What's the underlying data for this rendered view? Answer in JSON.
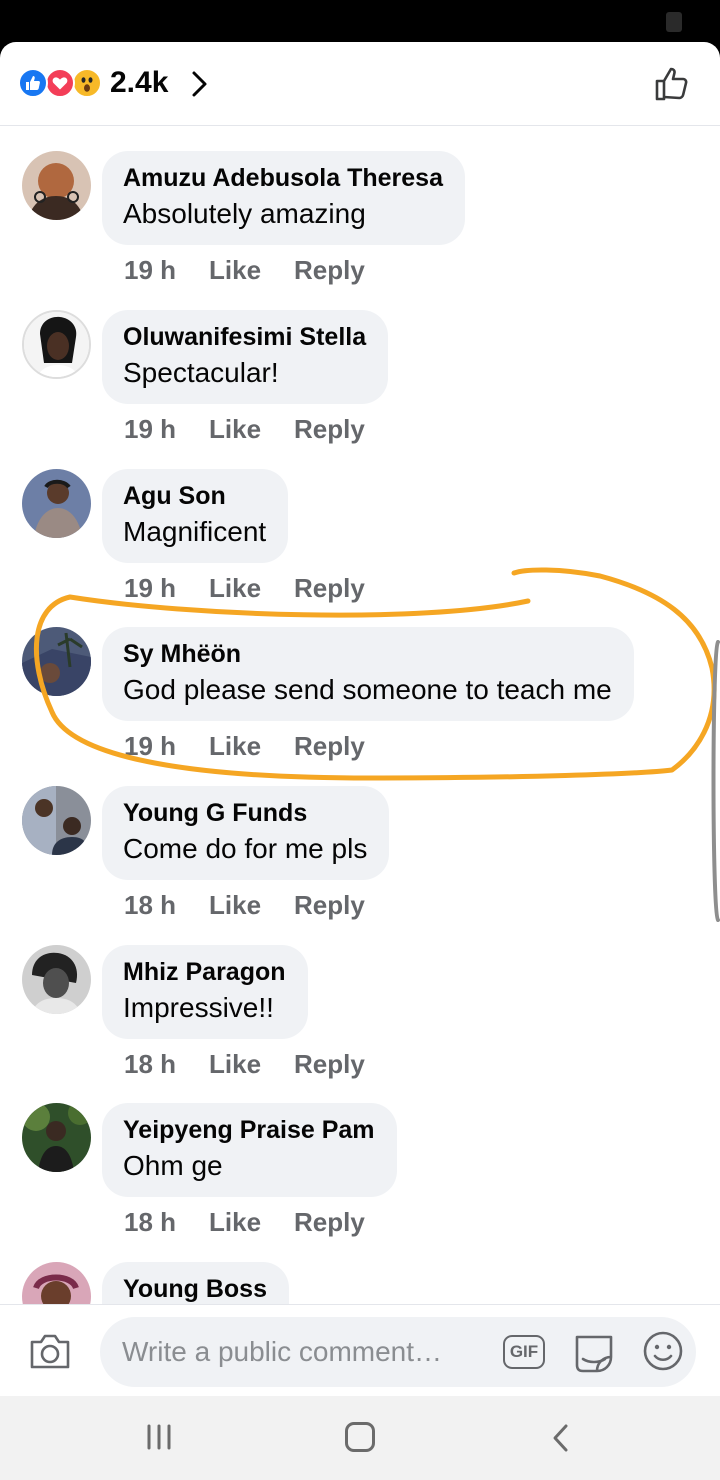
{
  "header": {
    "reaction_count": "2.4k",
    "reactions": [
      "like-icon",
      "love-icon",
      "wow-icon"
    ],
    "colors": {
      "like": "#1877f2",
      "love": "#f33e58",
      "wow": "#f7b928"
    }
  },
  "comments": [
    {
      "author": "Amuzu Adebusola Theresa",
      "text": "Absolutely amazing",
      "time": "19 h",
      "like": "Like",
      "reply": "Reply"
    },
    {
      "author": "Oluwanifesimi Stella",
      "text": "Spectacular!",
      "time": "19 h",
      "like": "Like",
      "reply": "Reply"
    },
    {
      "author": "Agu Son",
      "text": "Magnificent",
      "time": "19 h",
      "like": "Like",
      "reply": "Reply"
    },
    {
      "author": "Sy Mhëön",
      "text": "God please send someone to teach me",
      "time": "19 h",
      "like": "Like",
      "reply": "Reply",
      "highlighted": true
    },
    {
      "author": "Young G Funds",
      "text": "Come do for me pls",
      "time": "18 h",
      "like": "Like",
      "reply": "Reply"
    },
    {
      "author": "Mhiz Paragon",
      "text": "Impressive!!",
      "time": "18 h",
      "like": "Like",
      "reply": "Reply"
    },
    {
      "author": "Yeipyeng Praise Pam",
      "text": "Ohm ge",
      "time": "18 h",
      "like": "Like",
      "reply": "Reply"
    },
    {
      "author": "Young Boss"
    }
  ],
  "composer": {
    "placeholder": "Write a public comment…",
    "gif_label": "GIF"
  },
  "annotation_color": "#f5a623"
}
